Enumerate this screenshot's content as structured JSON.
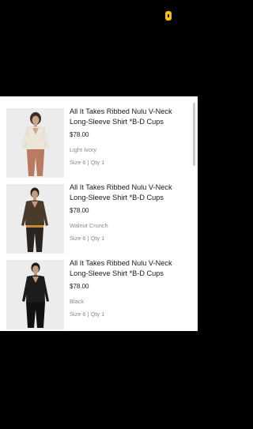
{
  "status": {
    "indicator_color": "#f2c200"
  },
  "items": [
    {
      "title": "All It Takes Ribbed Nulu V-Neck Long-Sleeve Shirt *B-D Cups",
      "price": "$78.00",
      "color": "Light Ivory",
      "meta": "Size 6 | Qty 1",
      "garment_color": "#ece6d8"
    },
    {
      "title": "All It Takes Ribbed Nulu V-Neck Long-Sleeve Shirt *B-D Cups",
      "price": "$78.00",
      "color": "Walnut Crunch",
      "meta": "Size 6 | Qty 1",
      "garment_color": "#4a3a2b"
    },
    {
      "title": "All It Takes Ribbed Nulu V-Neck Long-Sleeve Shirt *B-D Cups",
      "price": "$78.00",
      "color": "Black",
      "meta": "Size 6 | Qty 1",
      "garment_color": "#1c1c1c"
    }
  ]
}
